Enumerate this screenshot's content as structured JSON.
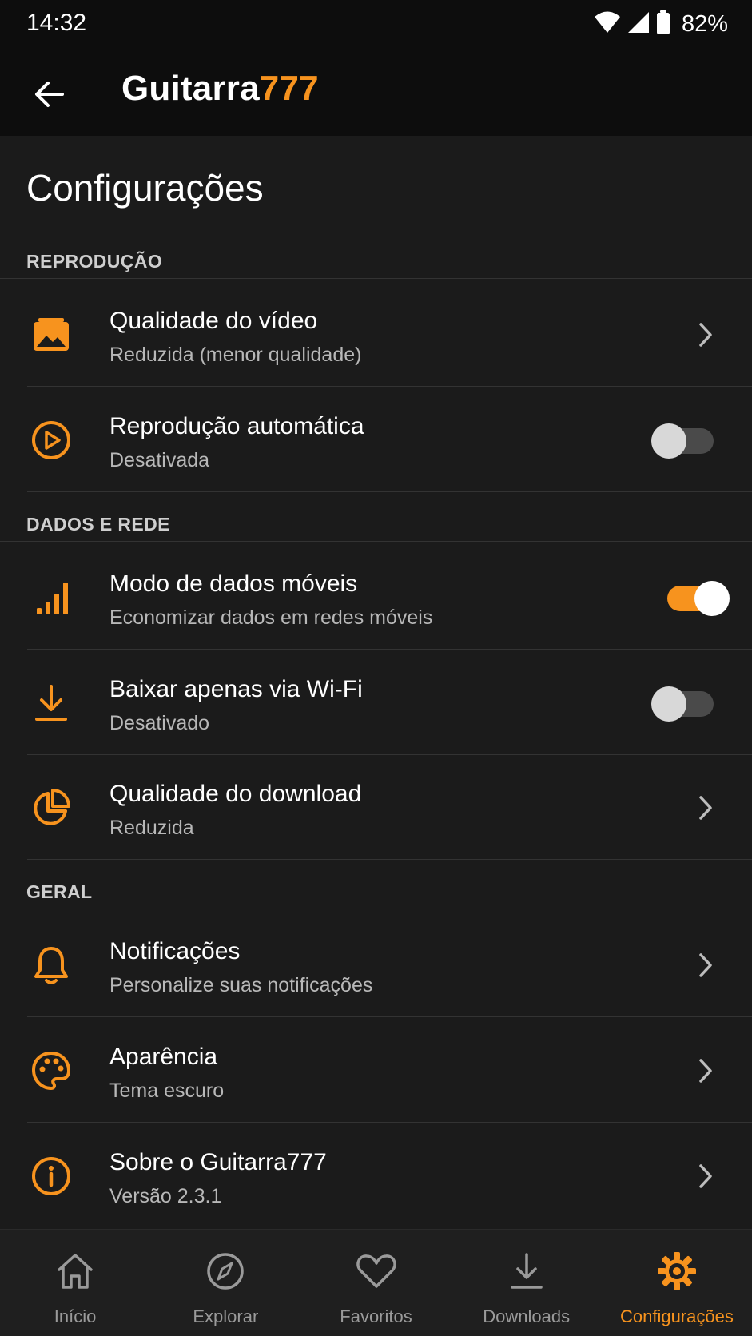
{
  "colors": {
    "accent": "#f7931e",
    "background": "#1b1b1b",
    "bar": "#0d0d0d",
    "text": "#ffffff",
    "muted_text": "#b8b8b8",
    "inactive_nav": "#9a9a9a"
  },
  "status_bar": {
    "time": "14:32",
    "battery": "82%",
    "icons": [
      "wifi-icon",
      "cellular-signal-icon",
      "battery-icon"
    ]
  },
  "app_bar": {
    "title_main": "Guitarra",
    "title_accent": "777",
    "back_icon": "arrow-left-icon"
  },
  "page": {
    "title": "Configurações"
  },
  "sections": {
    "reproducao": {
      "header": "REPRODUÇÃO",
      "items": [
        {
          "title": "Qualidade do vídeo",
          "subtitle": "Reduzida (menor qualidade)",
          "icon": "image-icon",
          "control": "chevron"
        },
        {
          "title": "Reprodução automática",
          "subtitle": "Desativada",
          "icon": "play-circle-icon",
          "control": "toggle",
          "on": false
        }
      ]
    },
    "dados": {
      "header": "DADOS E REDE",
      "items": [
        {
          "title": "Modo de dados móveis",
          "subtitle": "Economizar dados em redes móveis",
          "icon": "signal-bars-icon",
          "control": "toggle",
          "on": true
        },
        {
          "title": "Baixar apenas via Wi-Fi",
          "subtitle": "Desativado",
          "icon": "download-icon",
          "control": "toggle",
          "on": false
        },
        {
          "title": "Qualidade do download",
          "subtitle": "Reduzida",
          "icon": "pie-chart-icon",
          "control": "chevron"
        }
      ]
    },
    "geral": {
      "header": "GERAL",
      "items": [
        {
          "title": "Notificações",
          "subtitle": "Personalize suas notificações",
          "icon": "bell-icon",
          "control": "chevron"
        },
        {
          "title": "Aparência",
          "subtitle": "Tema escuro",
          "icon": "palette-icon",
          "control": "chevron"
        },
        {
          "title": "Sobre o Guitarra777",
          "subtitle": "Versão 2.3.1",
          "icon": "info-icon",
          "control": "chevron"
        }
      ]
    }
  },
  "bottom_nav": {
    "items": [
      {
        "label": "Início",
        "icon": "home-icon",
        "active": false
      },
      {
        "label": "Explorar",
        "icon": "compass-icon",
        "active": false
      },
      {
        "label": "Favoritos",
        "icon": "heart-icon",
        "active": false
      },
      {
        "label": "Downloads",
        "icon": "download-icon",
        "active": false
      },
      {
        "label": "Configurações",
        "icon": "gear-icon",
        "active": true
      }
    ]
  }
}
